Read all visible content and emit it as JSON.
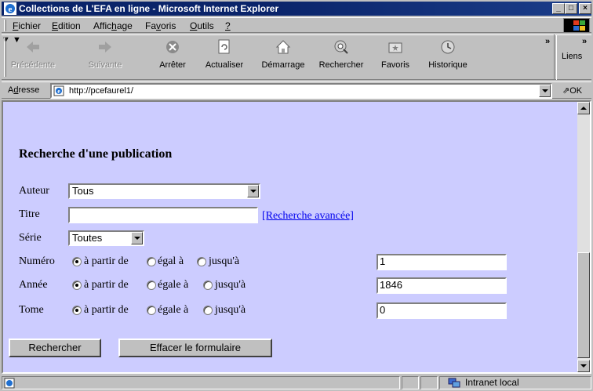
{
  "window": {
    "title": "Collections de L'EFA en ligne - Microsoft Internet Explorer",
    "controls": {
      "minimize": "_",
      "maximize": "□",
      "close": "×"
    }
  },
  "menu": {
    "items": [
      {
        "pre": "",
        "key": "F",
        "post": "ichier"
      },
      {
        "pre": "",
        "key": "E",
        "post": "dition"
      },
      {
        "pre": "Affic",
        "key": "h",
        "post": "age"
      },
      {
        "pre": "Fa",
        "key": "v",
        "post": "oris"
      },
      {
        "pre": "",
        "key": "O",
        "post": "utils"
      },
      {
        "pre": "",
        "key": "?",
        "post": ""
      }
    ]
  },
  "toolbar": {
    "back": "Précédente",
    "forward": "Suivante",
    "stop": "Arrêter",
    "refresh": "Actualiser",
    "home": "Démarrage",
    "search": "Rechercher",
    "favorites": "Favoris",
    "history": "Historique",
    "chevron": "»",
    "links": "Liens"
  },
  "address": {
    "label_pre": "A",
    "label_key": "d",
    "label_post": "resse",
    "url": "http://pcefaurel1/",
    "go": "OK",
    "go_arrow": "⇗"
  },
  "page": {
    "heading": "Recherche d'une publication",
    "author_label": "Auteur",
    "author_value": "Tous",
    "title_label": "Titre",
    "title_value": "",
    "advanced_link": "[Recherche avancée]",
    "series_label": "Série",
    "series_value": "Toutes",
    "number_label": "Numéro",
    "number_options": [
      "à partir de",
      "égal à",
      "jusqu'à"
    ],
    "number_value": "1",
    "year_label": "Année",
    "year_options": [
      "à partir de",
      "égale à",
      "jusqu'à"
    ],
    "year_value": "1846",
    "volume_label": "Tome",
    "volume_options": [
      "à partir de",
      "égale à",
      "jusqu'à"
    ],
    "volume_value": "0",
    "search_button": "Rechercher",
    "reset_button": "Effacer le formulaire"
  },
  "status": {
    "zone": "Intranet local"
  },
  "colors": {
    "page_background": "#ccccff",
    "titlebar": "#0a246a",
    "link": "#0000ee"
  },
  "icons": [
    "ie-logo-icon",
    "back-arrow-icon",
    "forward-arrow-icon",
    "stop-icon",
    "refresh-icon",
    "home-icon",
    "search-globe-icon",
    "favorites-icon",
    "history-icon",
    "windows-logo-icon",
    "page-icon",
    "intranet-zone-icon"
  ]
}
